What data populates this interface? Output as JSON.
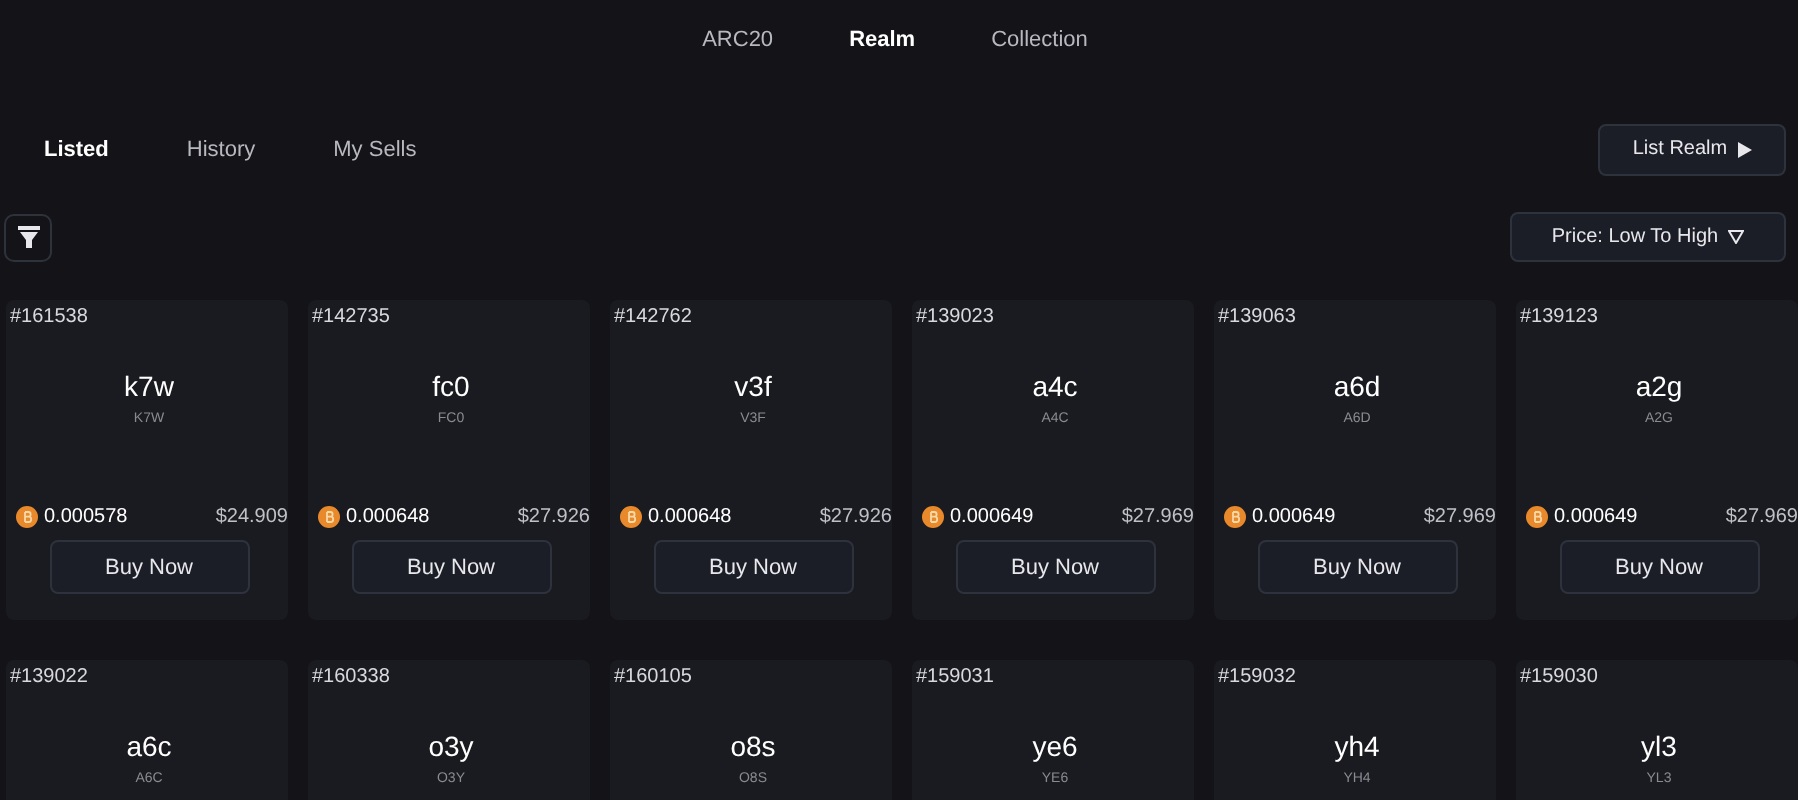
{
  "top_tabs": [
    {
      "label": "ARC20",
      "selected": false
    },
    {
      "label": "Realm",
      "selected": true
    },
    {
      "label": "Collection",
      "selected": false
    }
  ],
  "sub_tabs": [
    {
      "label": "Listed",
      "selected": true
    },
    {
      "label": "History",
      "selected": false
    },
    {
      "label": "My Sells",
      "selected": false
    }
  ],
  "list_button": "List Realm",
  "sort": {
    "label": "Price: Low To High"
  },
  "cards": [
    {
      "id": "#161538",
      "name": "k7w",
      "ticker": "K7W",
      "price": "0.000578",
      "usd": "$24.909",
      "button": "Buy Now"
    },
    {
      "id": "#142735",
      "name": "fc0",
      "ticker": "FC0",
      "price": "0.000648",
      "usd": "$27.926",
      "button": "Buy Now"
    },
    {
      "id": "#142762",
      "name": "v3f",
      "ticker": "V3F",
      "price": "0.000648",
      "usd": "$27.926",
      "button": "Buy Now"
    },
    {
      "id": "#139023",
      "name": "a4c",
      "ticker": "A4C",
      "price": "0.000649",
      "usd": "$27.969",
      "button": "Buy Now"
    },
    {
      "id": "#139063",
      "name": "a6d",
      "ticker": "A6D",
      "price": "0.000649",
      "usd": "$27.969",
      "button": "Buy Now"
    },
    {
      "id": "#139123",
      "name": "a2g",
      "ticker": "A2G",
      "price": "0.000649",
      "usd": "$27.969",
      "button": "Buy Now"
    },
    {
      "id": "#139022",
      "name": "a6c",
      "ticker": "A6C"
    },
    {
      "id": "#160338",
      "name": "o3y",
      "ticker": "O3Y"
    },
    {
      "id": "#160105",
      "name": "o8s",
      "ticker": "O8S"
    },
    {
      "id": "#159031",
      "name": "ye6",
      "ticker": "YE6"
    },
    {
      "id": "#159032",
      "name": "yh4",
      "ticker": "YH4"
    },
    {
      "id": "#159030",
      "name": "yl3",
      "ticker": "YL3"
    }
  ]
}
